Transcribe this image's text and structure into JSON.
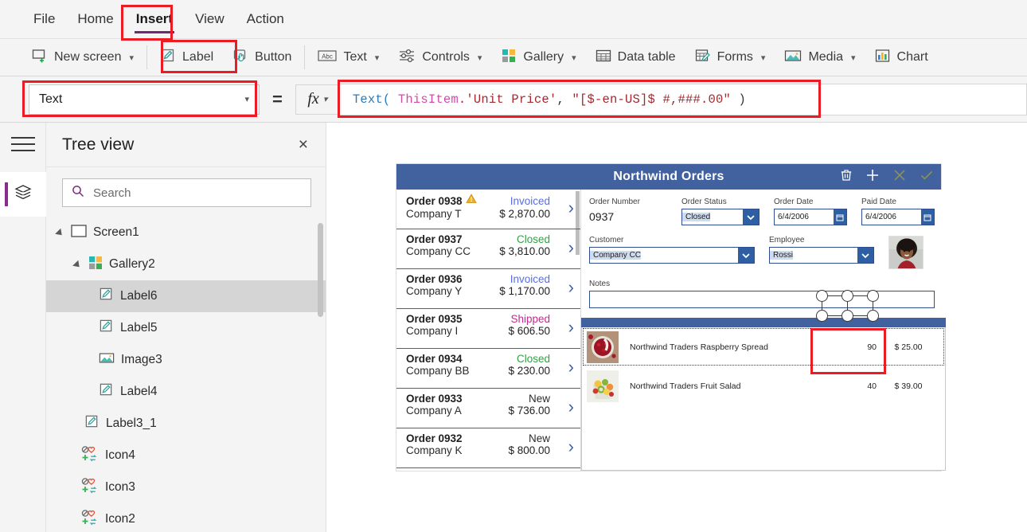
{
  "menu": {
    "items": [
      {
        "label": "File",
        "active": false
      },
      {
        "label": "Home",
        "active": false
      },
      {
        "label": "Insert",
        "active": true
      },
      {
        "label": "View",
        "active": false
      },
      {
        "label": "Action",
        "active": false
      }
    ]
  },
  "ribbon": {
    "items": [
      {
        "label": "New screen",
        "icon": "new-screen-icon",
        "caret": true
      },
      {
        "label": "Label",
        "icon": "label-pencil-icon",
        "caret": false
      },
      {
        "label": "Button",
        "icon": "button-hand-icon",
        "caret": false
      },
      {
        "label": "Text",
        "icon": "abc-text-icon",
        "caret": true
      },
      {
        "label": "Controls",
        "icon": "controls-sliders-icon",
        "caret": true
      },
      {
        "label": "Gallery",
        "icon": "gallery-squares-icon",
        "caret": true
      },
      {
        "label": "Data table",
        "icon": "data-table-icon",
        "caret": false
      },
      {
        "label": "Forms",
        "icon": "forms-icon",
        "caret": true
      },
      {
        "label": "Media",
        "icon": "media-image-icon",
        "caret": true
      },
      {
        "label": "Chart",
        "icon": "chart-bars-icon",
        "caret": false
      }
    ]
  },
  "formula": {
    "property_value": "Text",
    "equals": "=",
    "fx_label": "fx",
    "tokens": [
      {
        "t": "Text(",
        "c": "fn"
      },
      {
        "t": " ",
        "c": "pun"
      },
      {
        "t": "ThisItem",
        "c": "this"
      },
      {
        "t": ".'Unit Price'",
        "c": "prop"
      },
      {
        "t": ", ",
        "c": "pun"
      },
      {
        "t": "\"[$-en-US]$ #,###.00\"",
        "c": "str"
      },
      {
        "t": " )",
        "c": "pun"
      }
    ],
    "full_text": "Text( ThisItem.'Unit Price', \"[$-en-US]$ #,###.00\" )"
  },
  "treeview": {
    "title": "Tree view",
    "close_label": "×",
    "search_placeholder": "Search",
    "items": [
      {
        "label": "Screen1",
        "icon": "screen-icon",
        "indent": 0,
        "expander": true,
        "selected": false
      },
      {
        "label": "Gallery2",
        "icon": "gallery-squares-icon",
        "indent": 1,
        "expander": true,
        "selected": false
      },
      {
        "label": "Label6",
        "icon": "label-pencil-icon",
        "indent": 2,
        "expander": false,
        "selected": true
      },
      {
        "label": "Label5",
        "icon": "label-pencil-icon",
        "indent": 2,
        "expander": false,
        "selected": false
      },
      {
        "label": "Image3",
        "icon": "media-image-icon",
        "indent": 2,
        "expander": false,
        "selected": false
      },
      {
        "label": "Label4",
        "icon": "label-pencil-icon",
        "indent": 2,
        "expander": false,
        "selected": false
      },
      {
        "label": "Label3_1",
        "icon": "label-pencil-icon",
        "indent": 1,
        "expander": false,
        "selected": false
      },
      {
        "label": "Icon4",
        "icon": "icon-group-icon",
        "indent": 1,
        "expander": false,
        "selected": false
      },
      {
        "label": "Icon3",
        "icon": "icon-group-icon",
        "indent": 1,
        "expander": false,
        "selected": false
      },
      {
        "label": "Icon2",
        "icon": "icon-group-icon",
        "indent": 1,
        "expander": false,
        "selected": false
      }
    ]
  },
  "app": {
    "title": "Northwind Orders",
    "header_icons": [
      "trash-icon",
      "plus-icon",
      "cancel-x-icon",
      "confirm-check-icon"
    ],
    "orders": [
      {
        "id": "Order 0938",
        "company": "Company T",
        "status": "Invoiced",
        "status_color": "#5b6ee0",
        "amount": "$ 2,870.00",
        "warning": true
      },
      {
        "id": "Order 0937",
        "company": "Company CC",
        "status": "Closed",
        "status_color": "#34a047",
        "amount": "$ 3,810.00",
        "warning": false
      },
      {
        "id": "Order 0936",
        "company": "Company Y",
        "status": "Invoiced",
        "status_color": "#5b6ee0",
        "amount": "$ 1,170.00",
        "warning": false
      },
      {
        "id": "Order 0935",
        "company": "Company I",
        "status": "Shipped",
        "status_color": "#c42b8d",
        "amount": "$ 606.50",
        "warning": false
      },
      {
        "id": "Order 0934",
        "company": "Company BB",
        "status": "Closed",
        "status_color": "#34a047",
        "amount": "$ 230.00",
        "warning": false
      },
      {
        "id": "Order 0933",
        "company": "Company A",
        "status": "New",
        "status_color": "#2b2b2b",
        "amount": "$ 736.00",
        "warning": false
      },
      {
        "id": "Order 0932",
        "company": "Company K",
        "status": "New",
        "status_color": "#2b2b2b",
        "amount": "$ 800.00",
        "warning": false
      }
    ],
    "form": {
      "order_number_label": "Order Number",
      "order_number_value": "0937",
      "order_status_label": "Order Status",
      "order_status_value": "Closed",
      "order_date_label": "Order Date",
      "order_date_value": "6/4/2006",
      "paid_date_label": "Paid Date",
      "paid_date_value": "6/4/2006",
      "customer_label": "Customer",
      "customer_value": "Company CC",
      "employee_label": "Employee",
      "employee_value": "Rossi",
      "notes_label": "Notes",
      "notes_value": ""
    },
    "products": [
      {
        "name": "Northwind Traders Raspberry Spread",
        "qty": "90",
        "price": "$ 25.00",
        "selected": true,
        "thumb": "raspberry-spread-thumb"
      },
      {
        "name": "Northwind Traders Fruit Salad",
        "qty": "40",
        "price": "$ 39.00",
        "selected": false,
        "thumb": "fruit-salad-thumb"
      }
    ]
  },
  "colors": {
    "accent_purple": "#742774",
    "app_blue": "#41619f",
    "annotation_red": "#ec1c24",
    "selection_gray": "#d5d5d5"
  }
}
